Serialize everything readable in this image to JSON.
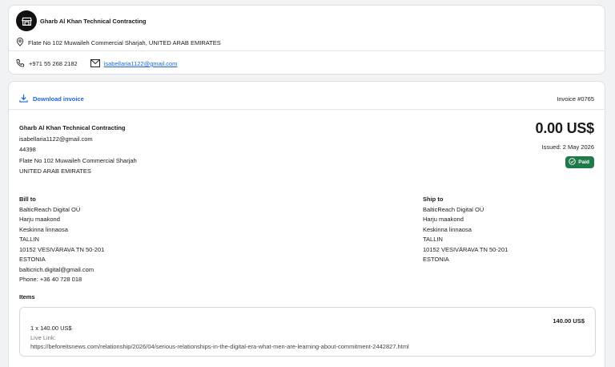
{
  "seller": {
    "logo_icon": "storefront-icon",
    "name": "Gharb Al Khan Technical Contracting",
    "address": "Flate No 102 Muwaileh Commercial Sharjah, UNITED ARAB EMIRATES",
    "phone": "+971 55 268 2182",
    "email": "isabellaria1122@gmail.com"
  },
  "invoice": {
    "download_label": "Download invoice",
    "number": "Invoice #0765",
    "total": "0.00 US$",
    "issued": "Issued: 2 May 2026",
    "status": "Paid",
    "from": {
      "name": "Gharb Al Khan Technical Contracting",
      "email": "isabellaria1122@gmail.com",
      "postal": "44398",
      "address": "Flate No 102 Muwaileh Commercial Sharjah",
      "country": "UNITED ARAB EMIRATES"
    },
    "bill_to": {
      "title": "Bill to",
      "lines": [
        "BalticReach Digital OÜ",
        "Harju maakond",
        "Keskinna linnaosa",
        "TALLIN",
        "10152 VESIVÄRAVA TN 50-201",
        "ESTONIA",
        "balticrich.digital@gmail.com",
        "Phone: +36 40 728 018"
      ]
    },
    "ship_to": {
      "title": "Ship to",
      "lines": [
        "BalticReach Digital OÜ",
        "Harju maakond",
        "Keskinna linnaosa",
        "TALLIN",
        "10152 VESIVÄRAVA TN 50-201",
        "ESTONIA"
      ]
    },
    "items_title": "Items",
    "items": [
      {
        "price": "140.00 US$",
        "qty": "1 x 140.00 US$",
        "link_label": "Live Link:",
        "link_url": "https://beforeitsnews.com/relationship/2026/04/serious-relationships-in-the-digital-era-what-men-are-learning-about-commitment-2442827.html"
      }
    ]
  },
  "colors": {
    "link": "#1a66d8",
    "paid": "#1f7a4a"
  }
}
